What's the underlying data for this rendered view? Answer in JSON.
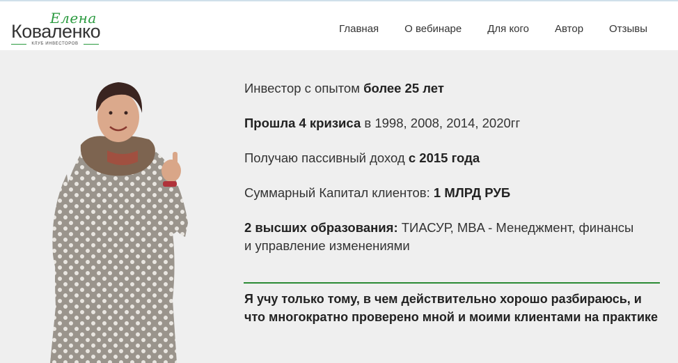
{
  "header": {
    "logo": {
      "script": "Елена",
      "name": "Коваленко",
      "tagline": "КЛУБ ИНВЕСТОРОВ"
    },
    "nav": [
      {
        "label": "Главная"
      },
      {
        "label": "О вебинаре"
      },
      {
        "label": "Для кого"
      },
      {
        "label": "Автор"
      },
      {
        "label": "Отзывы"
      }
    ]
  },
  "colors": {
    "accent_green": "#2a8a34",
    "background": "#efefef"
  },
  "photo": {
    "icon": "author-portrait"
  },
  "facts": [
    {
      "plain_before": "Инвестор с опытом ",
      "bold": "более 25 лет",
      "plain_after": ""
    },
    {
      "plain_before": "",
      "bold": "Прошла 4 кризиса",
      "plain_after": " в 1998, 2008, 2014, 2020гг"
    },
    {
      "plain_before": "Получаю пассивный доход ",
      "bold": "с 2015 года",
      "plain_after": ""
    },
    {
      "plain_before": "Суммарный Капитал клиентов: ",
      "bold": "1 МЛРД РУБ",
      "plain_after": ""
    },
    {
      "plain_before": "",
      "bold": "2 высших образования:",
      "plain_after": " ТИАСУР, MBA - Менеджмент, финансы и управление изменениями"
    }
  ],
  "quote": "Я учу только тому, в чем действительно хорошо разбираюсь, и что многократно проверено мной и моими клиентами на практике"
}
